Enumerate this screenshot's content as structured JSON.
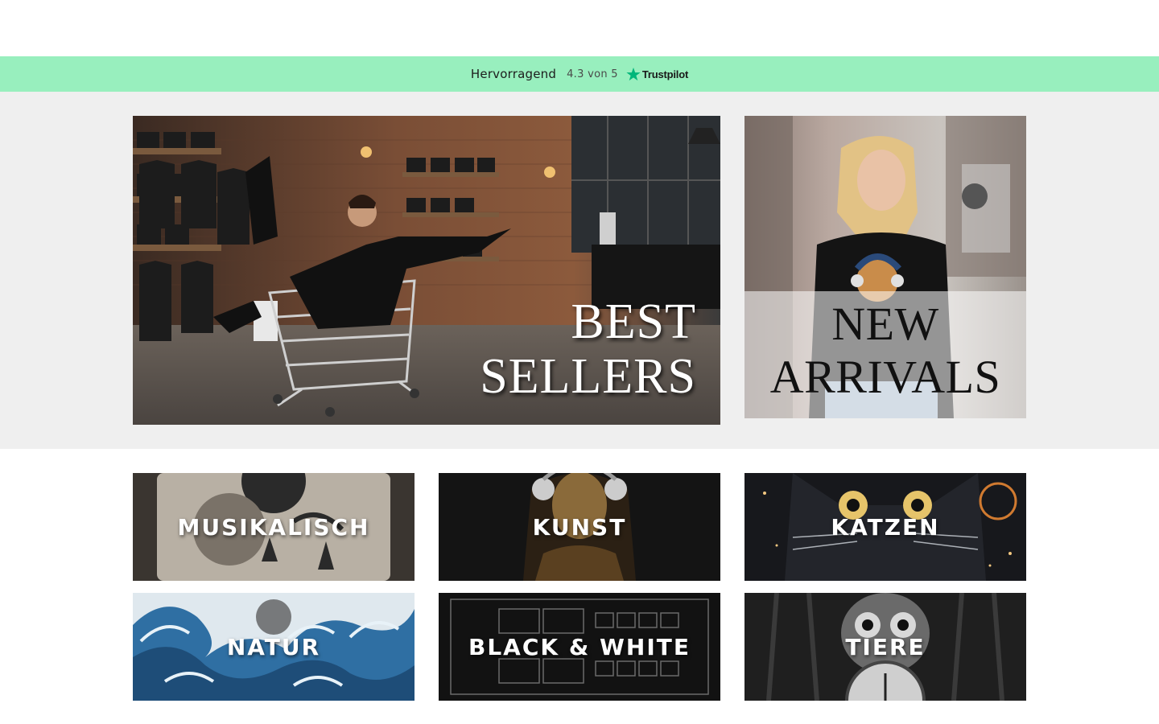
{
  "trustbar": {
    "rating_text": "Hervorragend",
    "score_text": "4.3 von 5",
    "brand": "Trustpilot",
    "star_icon": "star-icon",
    "background": "#98efbe",
    "star_color": "#00b67a"
  },
  "hero": {
    "best_sellers": {
      "line1": "BEST",
      "line2": "SELLERS"
    },
    "new_arrivals": {
      "line1": "NEW",
      "line2": "ARRIVALS"
    }
  },
  "categories": [
    {
      "label": "MUSIKALISCH"
    },
    {
      "label": "KUNST"
    },
    {
      "label": "KATZEN"
    },
    {
      "label": "NATUR"
    },
    {
      "label": "BLACK & WHITE"
    },
    {
      "label": "TIERE"
    }
  ]
}
